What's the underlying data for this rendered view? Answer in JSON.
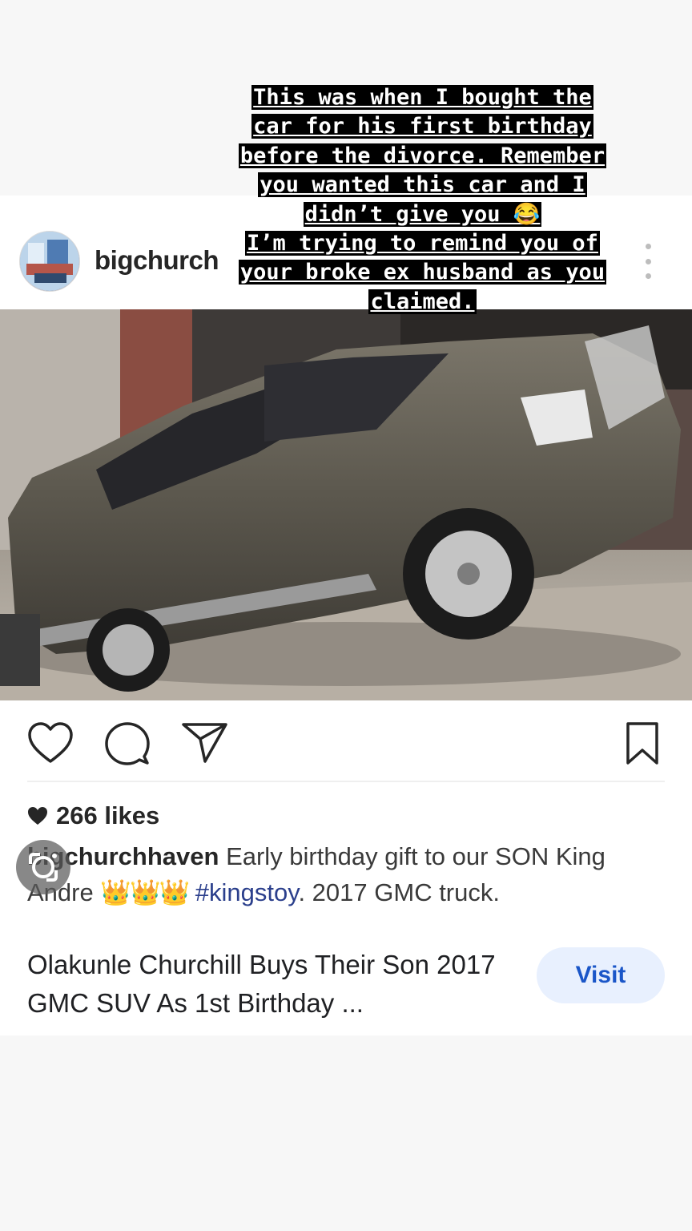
{
  "story": {
    "lines": [
      "This was when I bought the",
      "car for his first birthday",
      "before the divorce. Remember",
      "you wanted this car and I",
      "didn’t give you 😂",
      "I’m trying to remind you of",
      "your broke ex husband as you",
      "claimed."
    ]
  },
  "post": {
    "username": "bigchurch",
    "image_alt": "Gray GMC Yukon SUV parked in a compound",
    "likes": "266 likes",
    "caption": {
      "user": "bigchurchhaven",
      "text_part1": "Early birthday gift to our SON King Andre",
      "crowns": "👑👑👑",
      "hashtag": "#kingstoy",
      "text_part2": ". 2017 GMC truck."
    }
  },
  "link": {
    "title": "Olakunle Churchill Buys Their Son 2017 GMC SUV As 1st Birthday ...",
    "visit_label": "Visit"
  },
  "colors": {
    "visit_bg": "#e8f0fe",
    "visit_text": "#1a56c8",
    "hashtag": "#2b3f8c"
  }
}
